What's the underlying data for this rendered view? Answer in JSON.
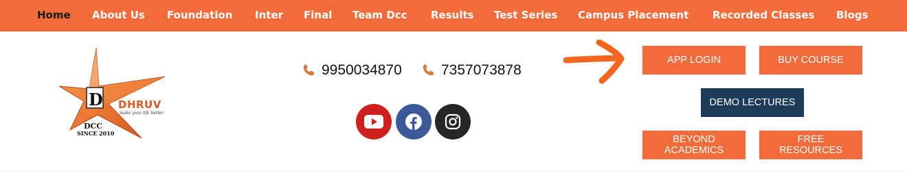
{
  "nav": {
    "items": [
      {
        "label": "Home",
        "active": true
      },
      {
        "label": "About Us"
      },
      {
        "label": "Foundation"
      },
      {
        "label": "Inter"
      },
      {
        "label": "Final"
      },
      {
        "label": "Team Dcc"
      },
      {
        "label": "Results"
      },
      {
        "label": "Test Series"
      },
      {
        "label": "Campus Placement"
      },
      {
        "label": "Recorded Classes"
      },
      {
        "label": "Blogs"
      }
    ]
  },
  "logo": {
    "letter": "D",
    "brand": "DHRUV",
    "tagline": "make your life better",
    "dcc": "DCC",
    "since": "SINCE 2010"
  },
  "contact": {
    "phones": [
      "9950034870",
      "7357073878"
    ],
    "phone_icon": "phone-icon"
  },
  "social": {
    "youtube": {
      "icon": "youtube-icon",
      "color": "#cd201f"
    },
    "facebook": {
      "icon": "facebook-icon",
      "color": "#3b5998"
    },
    "instagram": {
      "icon": "instagram-icon",
      "color": "#262626"
    }
  },
  "buttons": {
    "app_login": "APP LOGIN",
    "buy_course": "BUY COURSE",
    "demo_lectures": "DEMO LECTURES",
    "beyond_academics": "BEYOND ACADEMICS",
    "free_resources": "FREE RESOURCES"
  },
  "colors": {
    "brand_orange": "#f26b3a",
    "navy": "#1e3a5a",
    "phone_icon": "#d97a3a",
    "arrow": "#f2661f"
  }
}
